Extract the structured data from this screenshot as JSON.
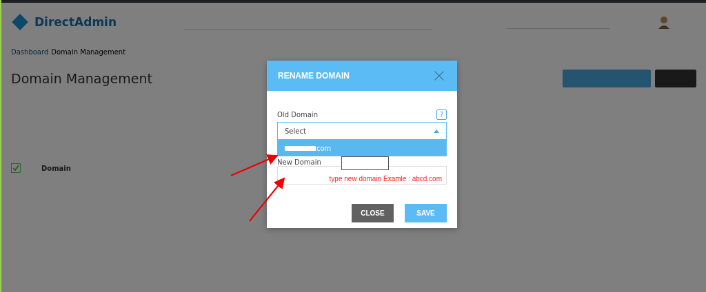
{
  "header": {
    "logo": "DirectAdmin"
  },
  "breadcrumb": [
    "Dashboard",
    "Domain Management"
  ],
  "page_title": "Domain Management",
  "table": {
    "select_all": {
      "checked": true
    },
    "columns": [
      "Domain"
    ]
  },
  "dialog": {
    "title": "RENAME DOMAIN",
    "old_domain": {
      "label": "Old Domain",
      "help": "?",
      "value": "Select",
      "expanded": true,
      "options": [
        {
          "label": "com",
          "selected": true
        }
      ]
    },
    "new_domain": {
      "label": "New Domain"
    },
    "buttons": [
      {
        "label": "CLOSE",
        "kind": "secondary"
      },
      {
        "label": "SAVE",
        "kind": "primary"
      }
    ]
  },
  "annotation": {
    "note": "type new domain Examle : abcd.com"
  }
}
